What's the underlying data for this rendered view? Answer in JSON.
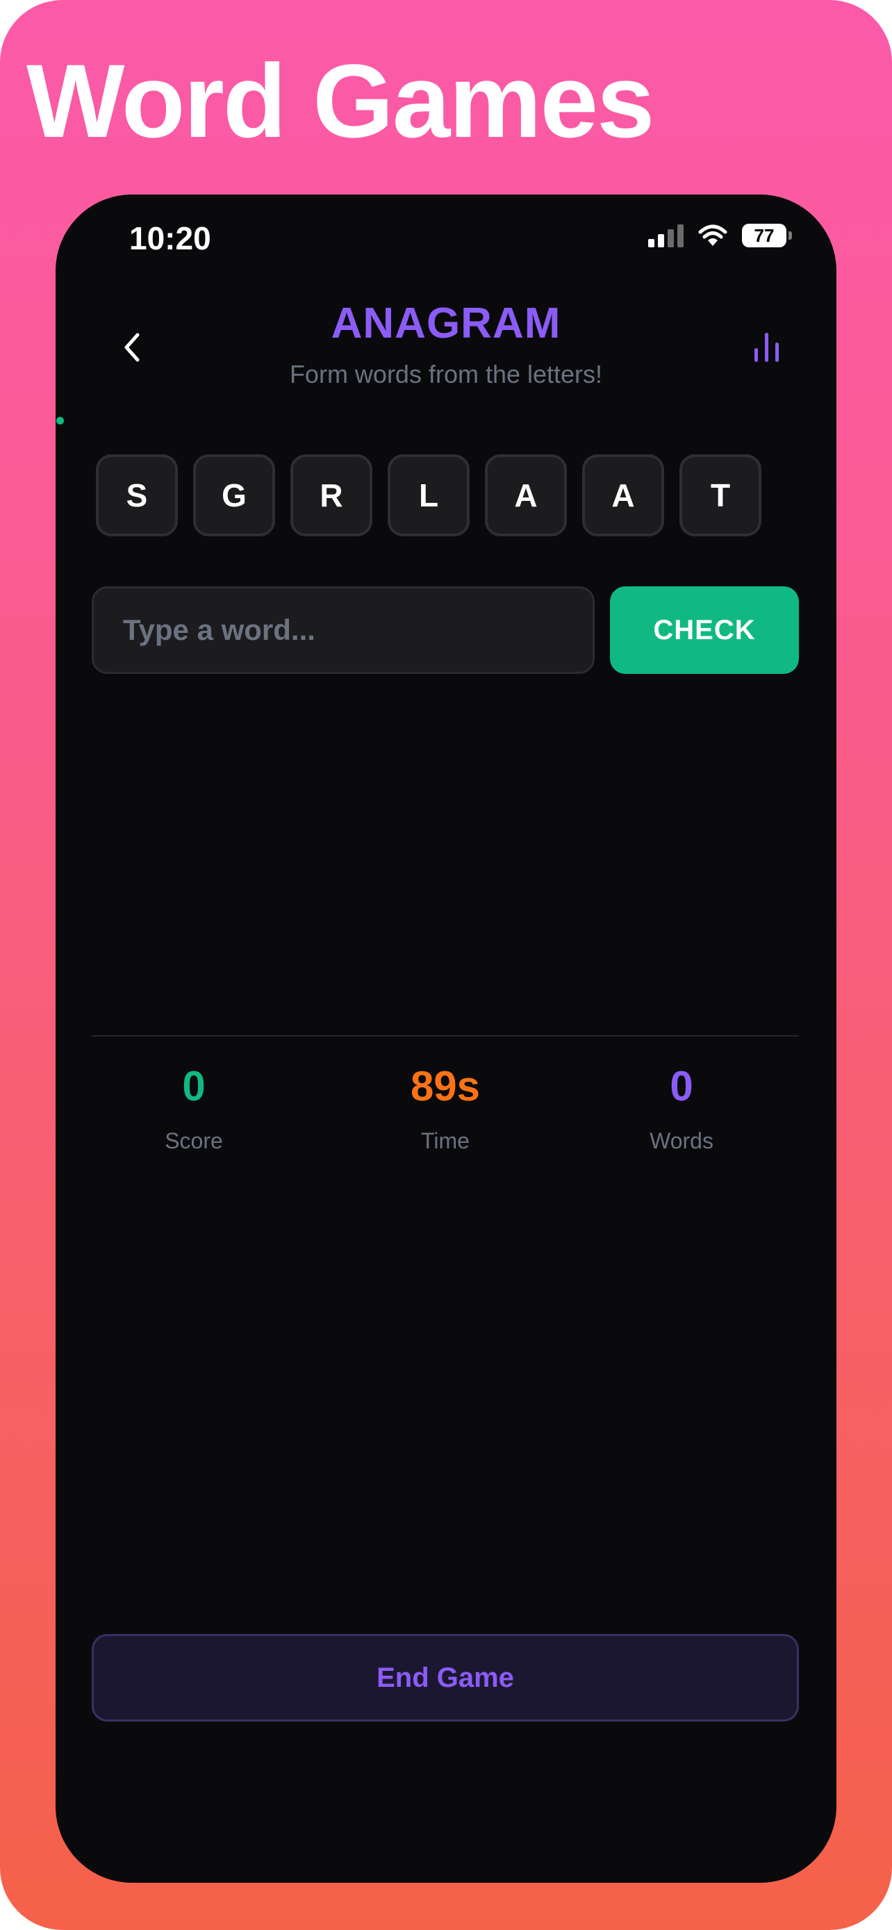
{
  "banner": {
    "title": "Word Games"
  },
  "status_bar": {
    "time": "10:20",
    "battery": "77"
  },
  "header": {
    "title": "ANAGRAM",
    "subtitle": "Form words from the letters!",
    "back_icon": "chevron-left-icon",
    "stats_icon": "bar-chart-icon"
  },
  "letters": [
    "S",
    "G",
    "R",
    "L",
    "A",
    "A",
    "T"
  ],
  "input": {
    "placeholder": "Type a word...",
    "value": ""
  },
  "check_button": {
    "label": "CHECK"
  },
  "stats": [
    {
      "value": "0",
      "label": "Score",
      "color": "#10b981"
    },
    {
      "value": "89s",
      "label": "Time",
      "color": "#f97316"
    },
    {
      "value": "0",
      "label": "Words",
      "color": "#8b5cf6"
    }
  ],
  "end_button": {
    "label": "End Game"
  },
  "colors": {
    "accent_purple": "#8b5cf6",
    "accent_green": "#10b981",
    "accent_orange": "#f97316",
    "background": "#0a0a0c"
  }
}
